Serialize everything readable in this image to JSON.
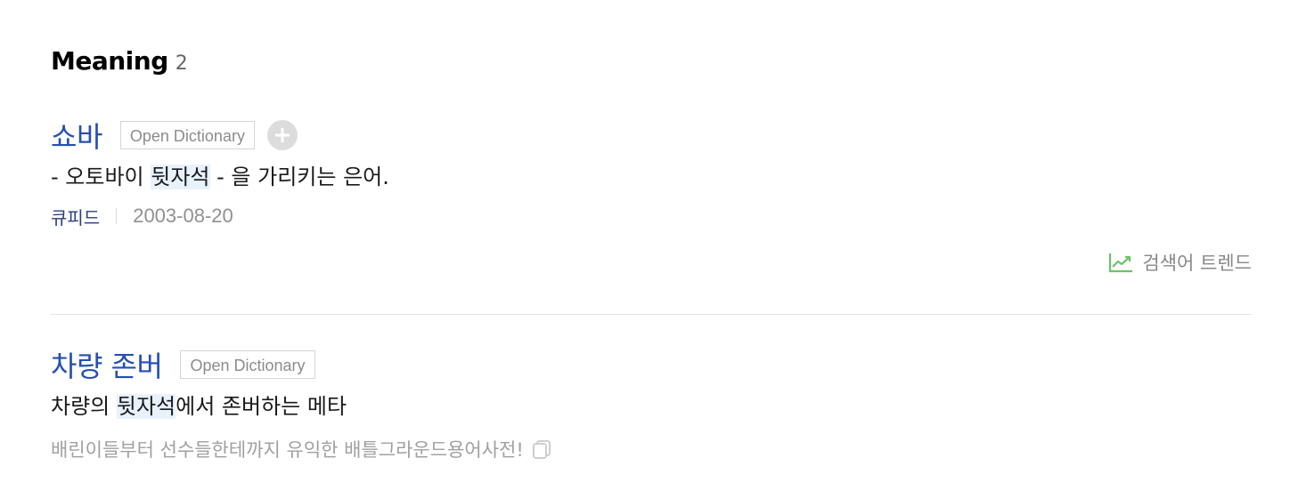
{
  "section": {
    "title": "Meaning",
    "count": "2"
  },
  "entries": [
    {
      "term": "쇼바",
      "source": "Open Dictionary",
      "definition_before": "- 오토바이 ",
      "definition_highlight": "뒷자석",
      "definition_after": " - 을 가리키는 은어.",
      "author": "큐피드",
      "date": "2003-08-20",
      "trend_label": "검색어 트렌드"
    },
    {
      "term": "차량 존버",
      "source": "Open Dictionary",
      "definition_before": "차량의 ",
      "definition_highlight": "뒷자석",
      "definition_after": "에서 존버하는 메타",
      "description": "배린이들부터 선수들한테까지 유익한 배틀그라운드용어사전!"
    }
  ],
  "colors": {
    "term": "#2450b2",
    "highlight": "#e8f2fd",
    "trend_icon": "#6cc36a"
  },
  "icons": {
    "add": "plus-circle-icon",
    "trend": "trend-chart-icon",
    "copy": "copy-icon"
  }
}
